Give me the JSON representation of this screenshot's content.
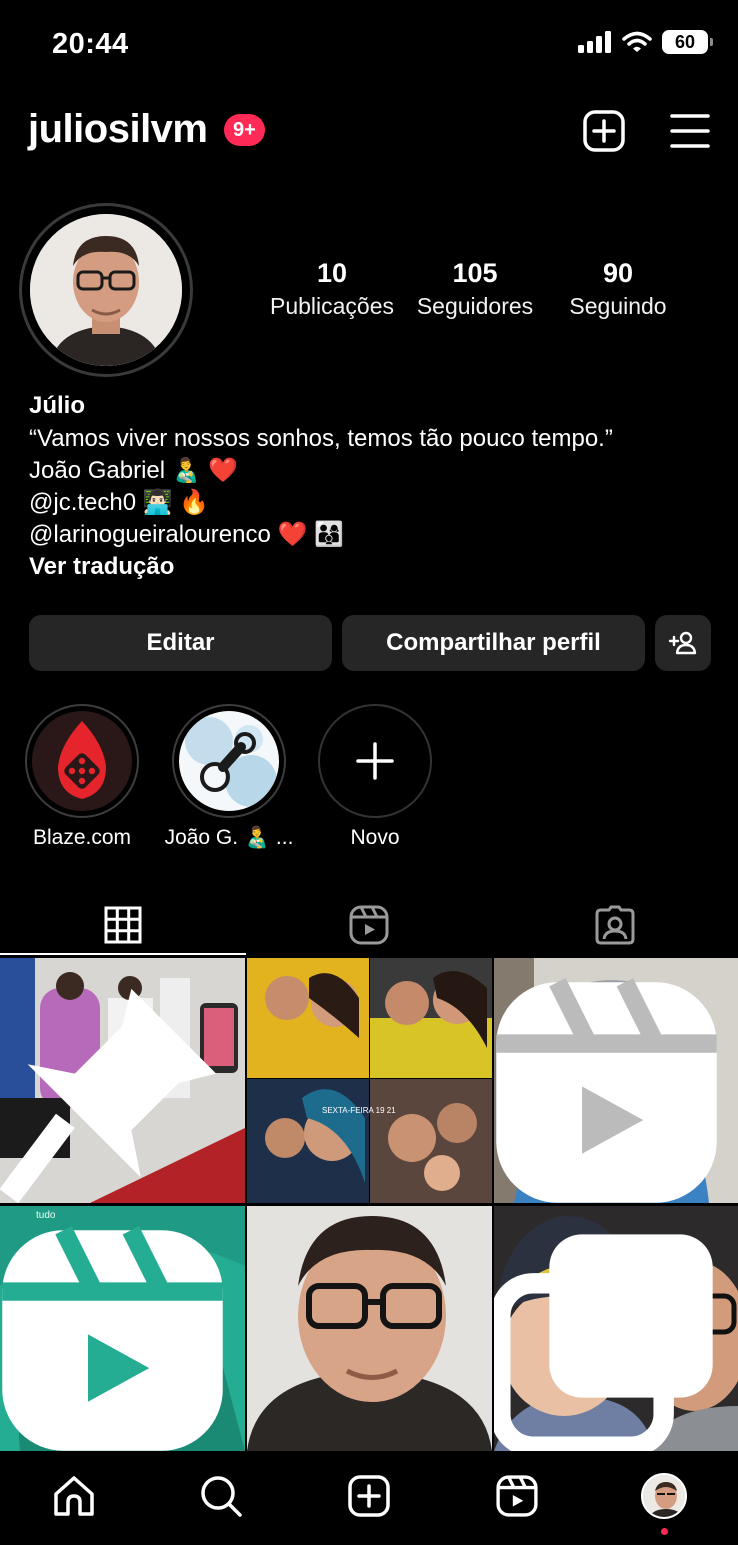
{
  "status_bar": {
    "time": "20:44",
    "battery": "60"
  },
  "header": {
    "username": "juliosilvm",
    "notification_badge": "9+"
  },
  "stats": [
    {
      "value": "10",
      "label": "Publicações"
    },
    {
      "value": "105",
      "label": "Seguidores"
    },
    {
      "value": "90",
      "label": "Seguindo"
    }
  ],
  "bio": {
    "name": "Júlio",
    "lines": [
      "“Vamos viver nossos sonhos, temos tão pouco tempo.”",
      "João Gabriel 👨‍🍼 ❤️",
      "@jc.tech0 👨🏻‍💻 🔥",
      "@larinogueiralourenco ❤️ 👨‍👩‍👦"
    ],
    "translate": "Ver tradução"
  },
  "actions": {
    "edit": "Editar",
    "share": "Compartilhar perfil"
  },
  "highlights": [
    {
      "label": "Blaze.com"
    },
    {
      "label": "João G. 👨‍🍼 ..."
    },
    {
      "label": "Novo"
    }
  ],
  "tabs": [
    "grid-icon",
    "reels-icon",
    "tagged-icon"
  ],
  "grid_posts": [
    {
      "badge": "pin-icon"
    },
    {
      "badge": ""
    },
    {
      "badge": "reels-icon"
    },
    {
      "badge": "reels-icon",
      "overlay_text": "tudo"
    },
    {
      "badge": ""
    },
    {
      "badge": "carousel-icon"
    }
  ],
  "grid_overlay_text": "SEXTA-FEIRA 19 21",
  "bottom_nav": [
    "home-icon",
    "search-icon",
    "create-icon",
    "reels-icon",
    "profile-avatar"
  ],
  "colors": {
    "background": "#000000",
    "button": "#262626",
    "badge": "#ff2a55"
  }
}
